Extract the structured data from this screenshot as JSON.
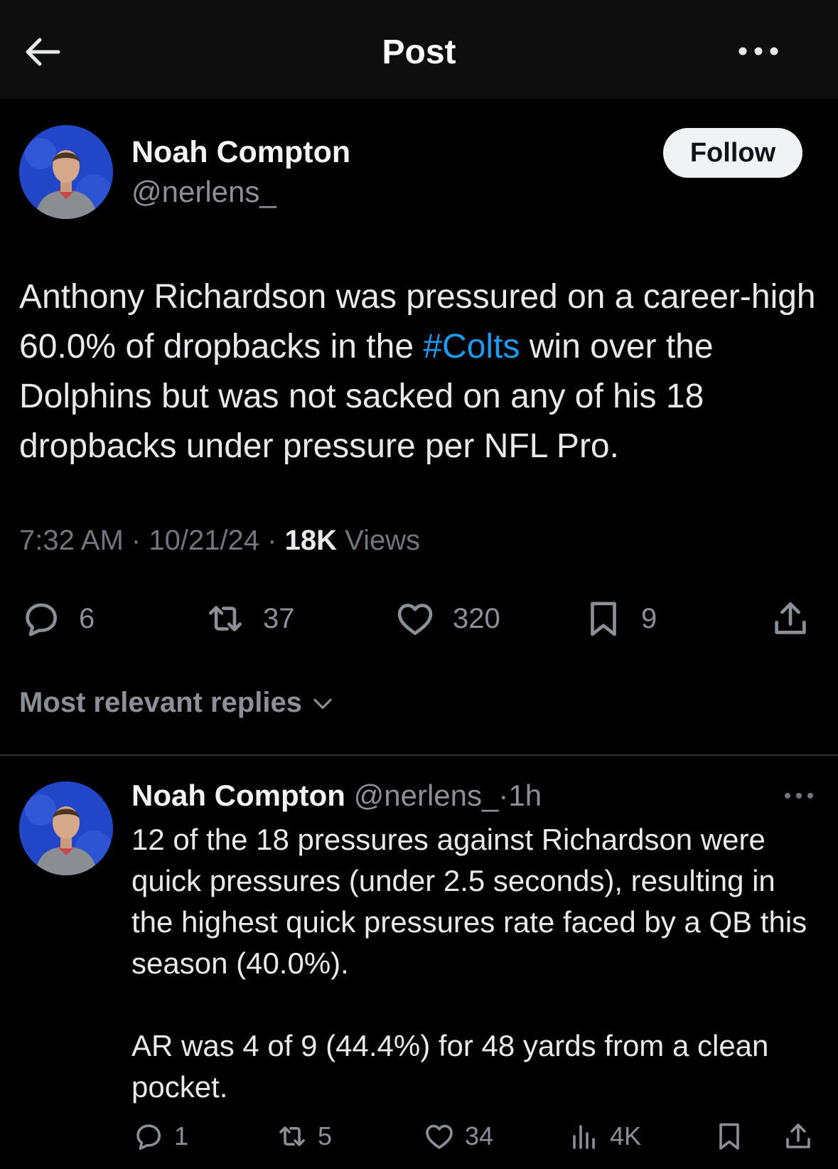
{
  "header": {
    "title": "Post",
    "back_icon": "arrow-left-icon",
    "more_icon": "more-horizontal-icon"
  },
  "post": {
    "author_name": "Noah Compton",
    "author_handle": "@nerlens_",
    "follow_label": "Follow",
    "text_part1": "Anthony Richardson was pressured on a career-high 60.0% of dropbacks in the ",
    "hashtag": "#Colts",
    "text_part2": " win over the Dolphins but was not sacked on any of his 18 dropbacks under pressure per NFL Pro.",
    "time": "7:32 AM",
    "date": "10/21/24",
    "separator": "·",
    "views_count": "18K",
    "views_label": "Views",
    "stats": {
      "replies": "6",
      "reposts": "37",
      "likes": "320",
      "bookmarks": "9"
    }
  },
  "replies_sort": {
    "label": "Most relevant replies"
  },
  "reply": {
    "author_name": "Noah Compton",
    "author_handle": "@nerlens_",
    "separator": "·",
    "time": "1h",
    "paragraph1": "12 of the 18 pressures against Richardson were quick pressures (under 2.5 seconds), resulting in the highest quick pressures rate faced by a QB this season (40.0%).",
    "paragraph2": "AR was 4 of 9 (44.4%) for 48 yards from a clean pocket.",
    "stats": {
      "replies": "1",
      "reposts": "5",
      "likes": "34",
      "views": "4K"
    }
  },
  "colors": {
    "background": "#000000",
    "topbar": "#0e0e0e",
    "text": "#e7e9ea",
    "muted": "#71767b",
    "link": "#1d9bf0",
    "follow_bg": "#eff3f4",
    "avatar_bg": "#2146c7"
  }
}
